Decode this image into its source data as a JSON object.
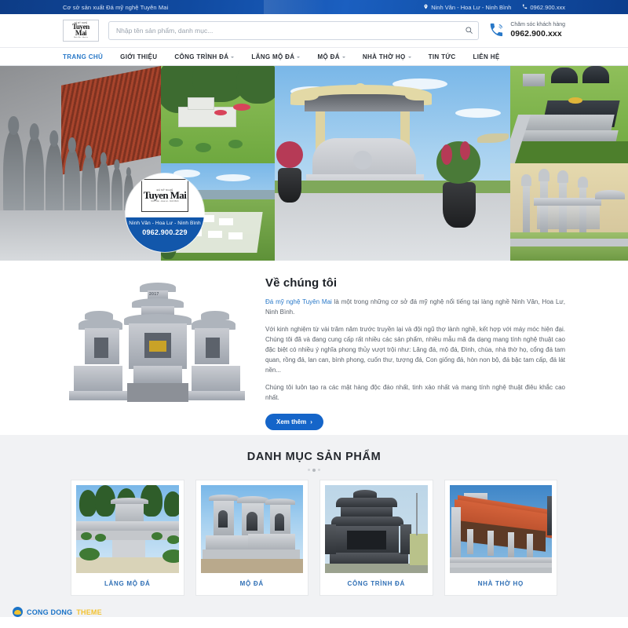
{
  "topbar": {
    "tagline": "Cơ sở sản xuất Đá mỹ nghệ Tuyên Mai",
    "location_icon": "map-pin-icon",
    "location": "Ninh Vân - Hoa Lư - Ninh Bình",
    "phone_icon": "phone-icon",
    "phone": "0962.900.xxx"
  },
  "header": {
    "logo": {
      "small_top": "ĐÁ MỸ NGHỆ",
      "name": "Tuyen Mai",
      "small_bottom": "Ninh Vân - Hoa Lư"
    },
    "search": {
      "placeholder": "Nhập tên sản phẩm, danh mục...",
      "value": "",
      "icon": "search-icon"
    },
    "hotline": {
      "icon": "phone-ringing-icon",
      "label": "Chăm sóc khách hàng",
      "number": "0962.900.xxx"
    }
  },
  "nav": {
    "items": [
      {
        "label": "TRANG CHỦ",
        "active": true,
        "has_dropdown": false
      },
      {
        "label": "GIỚI THIỆU",
        "active": false,
        "has_dropdown": false
      },
      {
        "label": "CÔNG TRÌNH ĐÁ",
        "active": false,
        "has_dropdown": true
      },
      {
        "label": "LĂNG MỘ ĐÁ",
        "active": false,
        "has_dropdown": true
      },
      {
        "label": "MỘ ĐÁ",
        "active": false,
        "has_dropdown": true
      },
      {
        "label": "NHÀ THỜ HỌ",
        "active": false,
        "has_dropdown": true
      },
      {
        "label": "TIN TỨC",
        "active": false,
        "has_dropdown": false
      },
      {
        "label": "LIÊN HỆ",
        "active": false,
        "has_dropdown": false
      }
    ]
  },
  "hero": {
    "badge": {
      "logo_small_top": "ĐÁ MỸ NGHỆ",
      "logo_name": "Tuyen Mai",
      "logo_small_bottom": "Ninh Vân - Hoa Lư - Ninh Bình",
      "address": "Ninh Vân - Hoa Lư - Ninh Bình",
      "phone": "0962.900.229"
    },
    "photos": [
      {
        "alt": "Dãy tượng đá trong hành lang chùa"
      },
      {
        "alt": "Khu lăng mộ đá giữa vườn cây"
      },
      {
        "alt": "Nghĩa trang đá trắng nhìn từ trên cao"
      },
      {
        "alt": "Lăng mộ đá có mái đình và cây cảnh"
      },
      {
        "alt": "Mộ đá granite đen trên nền cỏ"
      },
      {
        "alt": "Cổng đá tam quan và nhà thờ họ"
      }
    ]
  },
  "about": {
    "title": "Về chúng tôi",
    "link_text": "Đá mỹ nghệ Tuyên Mai",
    "paragraph1_rest": " là một trong những cơ sở đá mỹ nghệ nổi tiếng tại làng nghề Ninh Vân, Hoa Lư, Ninh Bình.",
    "paragraph2": "Với kinh nghiệm từ vài trăm năm trước truyền lại và đội ngũ thợ lành nghề, kết hợp với máy móc hiện đại. Chúng tôi đã và đang cung cấp rất nhiều các sản phẩm, nhiều mẫu mã đa dạng mang tính nghệ thuật cao đặc biệt có nhiều ý nghĩa phong thủy vượt trội như: Lăng đá, mộ đá, Đình, chùa, nhà thờ họ, cổng đá tam quan, rồng đá, lan can, bình phong, cuốn thư, tượng đá, Con giống đá, hòn non bộ, đá bậc tam cấp, đá lát nền...",
    "paragraph3": "Chúng tôi luôn tạo ra các mặt hàng độc đáo nhất, tinh xảo nhất và mang tính nghệ thuật điêu khắc cao nhất.",
    "button": "Xem thêm",
    "button_icon": "chevron-right-icon",
    "image_alt": "Lăng mộ đá ba mái có khắc năm 2017",
    "image_year": "2017"
  },
  "products": {
    "title": "DANH MỤC SẢN PHẨM",
    "dots": 3,
    "active_dot": 1,
    "cards": [
      {
        "label": "LĂNG MỘ ĐÁ",
        "alt": "Lăng mộ đá trên đồi có bậc thang"
      },
      {
        "label": "MỘ ĐÁ",
        "alt": "Cụm mộ đá mái vòm"
      },
      {
        "label": "CÔNG TRÌNH ĐÁ",
        "alt": "Công trình đá xanh đen chạm khắc"
      },
      {
        "label": "NHÀ THỜ HỌ",
        "alt": "Nhà thờ họ mái ngói đỏ"
      }
    ]
  },
  "watermark": {
    "part1": "CONG DONG",
    "part2": "THEME",
    "icon": "cd-logo-icon"
  },
  "colors": {
    "brand_blue": "#1565c9",
    "topbar_blue": "#104aa0",
    "badge_blue": "#1257ab",
    "label_blue": "#2f6fb5",
    "wm_blue": "#1a73c7",
    "wm_yellow": "#f2c230",
    "products_bg": "#f1f2f4"
  }
}
